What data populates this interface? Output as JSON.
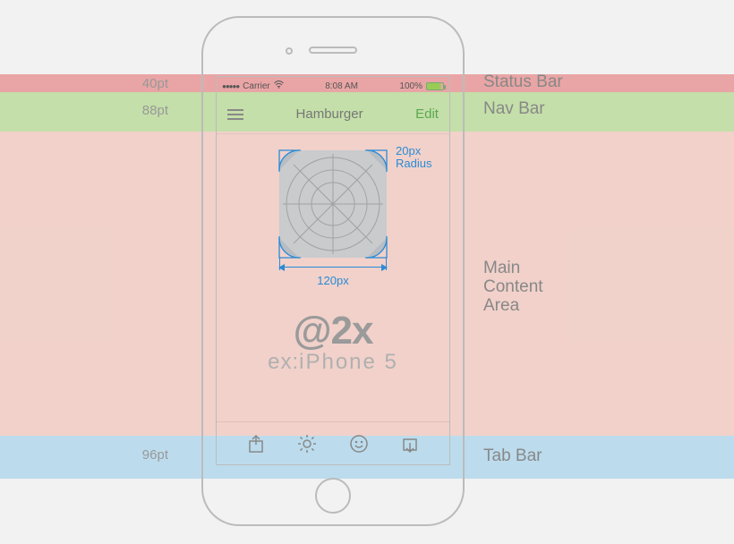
{
  "labels": {
    "pt40": "40pt",
    "pt88": "88pt",
    "pt96": "96pt",
    "status": "Status Bar",
    "nav": "Nav Bar",
    "main_line1": "Main",
    "main_line2": "Content",
    "main_line3": "Area",
    "tab": "Tab Bar"
  },
  "statusbar": {
    "carrier": "Carrier",
    "signal_dots": "●●●●●",
    "wifi": "wifi",
    "time": "8:08 AM",
    "battery_pct": "100%"
  },
  "navbar": {
    "title": "Hamburger",
    "edit": "Edit"
  },
  "icon": {
    "radius_label_l1": "20px",
    "radius_label_l2": "Radius",
    "width_label": "120px"
  },
  "scale": {
    "big": "@2x",
    "sub_prefix": "ex:",
    "sub_model": "iPhone 5"
  },
  "tabbar": {
    "items": [
      "share-icon",
      "gear-icon",
      "smile-icon",
      "reply-icon"
    ]
  }
}
